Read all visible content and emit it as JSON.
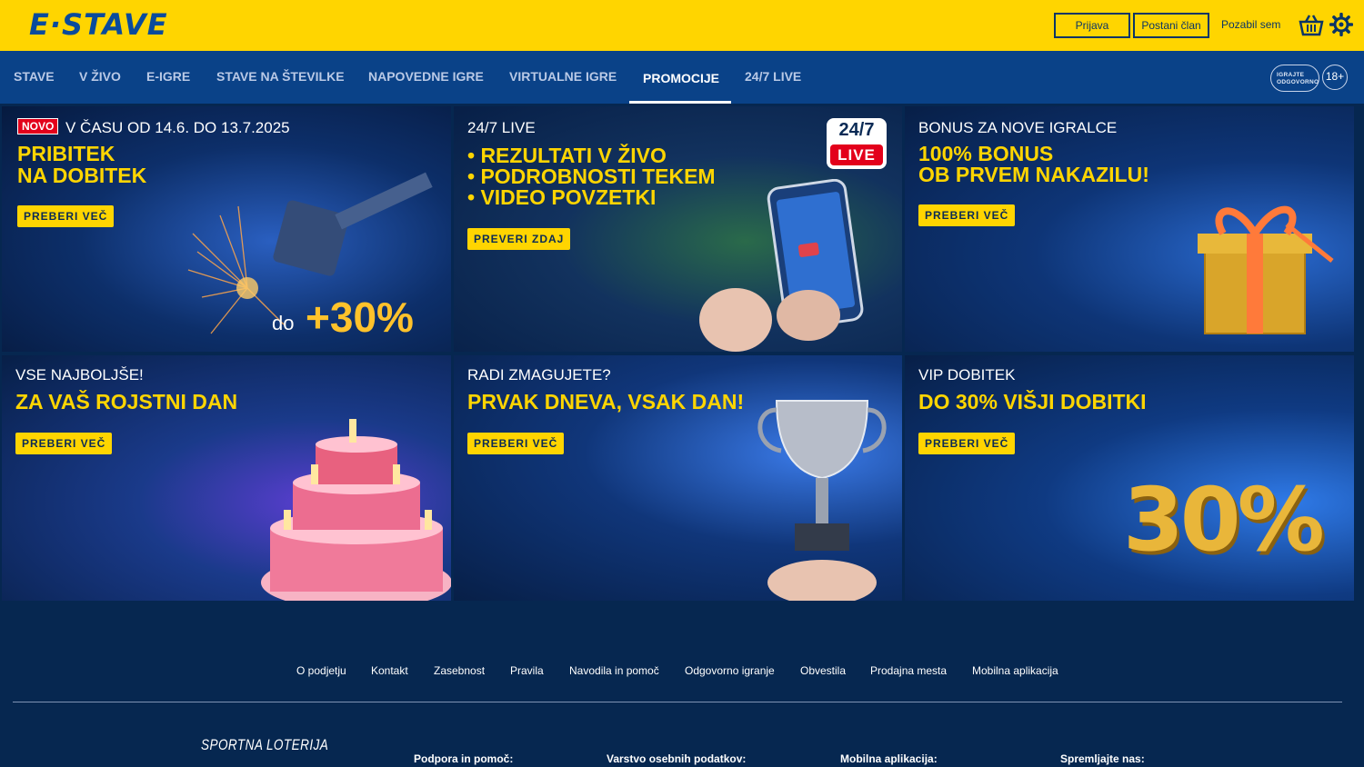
{
  "header": {
    "logo": "E·STAVE",
    "login_label": "Prijava",
    "register_label": "Postani član",
    "forgot_label": "Pozabil sem",
    "accent": "#ffd500",
    "brand_blue": "#0a4288"
  },
  "nav": {
    "items": [
      {
        "label": "STAVE"
      },
      {
        "label": "V ŽIVO"
      },
      {
        "label": "E-IGRE"
      },
      {
        "label": "STAVE NA ŠTEVILKE"
      },
      {
        "label": "NAPOVEDNE IGRE"
      },
      {
        "label": "VIRTUALNE IGRE"
      },
      {
        "label": "PROMOCIJE",
        "active": true
      },
      {
        "label": "24/7 LIVE"
      }
    ],
    "responsible_line1": "IGRAJTE",
    "responsible_line2": "ODGOVORNO",
    "age_label": "18+"
  },
  "promos": [
    {
      "badge": "NOVO",
      "kicker": "V ČASU OD 14.6. DO 13.7.2025",
      "headline_lines": [
        "PRIBITEK",
        "NA DOBITEK"
      ],
      "cta": "PREBERI VEČ",
      "art_prefix": "do",
      "art_value": "+30%"
    },
    {
      "kicker": "24/7 LIVE",
      "headline_lines": [
        "• REZULTATI V ŽIVO",
        "• PODROBNOSTI TEKEM",
        "• VIDEO POVZETKI"
      ],
      "cta": "PREVERI ZDAJ",
      "art_badge_top": "24/7",
      "art_badge_bottom": "LIVE"
    },
    {
      "kicker": "BONUS ZA NOVE IGRALCE",
      "headline_lines": [
        "100% BONUS",
        "OB PRVEM NAKAZILU!"
      ],
      "cta": "PREBERI VEČ"
    },
    {
      "kicker": "VSE NAJBOLJŠE!",
      "headline_lines": [
        "ZA VAŠ ROJSTNI DAN"
      ],
      "cta": "PREBERI VEČ"
    },
    {
      "kicker": "RADI ZMAGUJETE?",
      "headline_lines": [
        "PRVAK DNEVA, VSAK DAN!"
      ],
      "cta": "PREBERI VEČ"
    },
    {
      "kicker": "VIP DOBITEK",
      "headline_lines": [
        "DO 30% VIŠJI DOBITKI"
      ],
      "cta": "PREBERI VEČ",
      "art_value": "30%"
    }
  ],
  "footer": {
    "links": [
      "O podjetju",
      "Kontakt",
      "Zasebnost",
      "Pravila",
      "Navodila in pomoč",
      "Odgovorno igranje",
      "Obvestila",
      "Prodajna mesta",
      "Mobilna aplikacija"
    ],
    "brand": "SPORTNA LOTERIJA",
    "columns": [
      "Podpora in pomoč:",
      "Varstvo osebnih podatkov:",
      "Mobilna aplikacija:",
      "Spremljajte nas:"
    ]
  }
}
